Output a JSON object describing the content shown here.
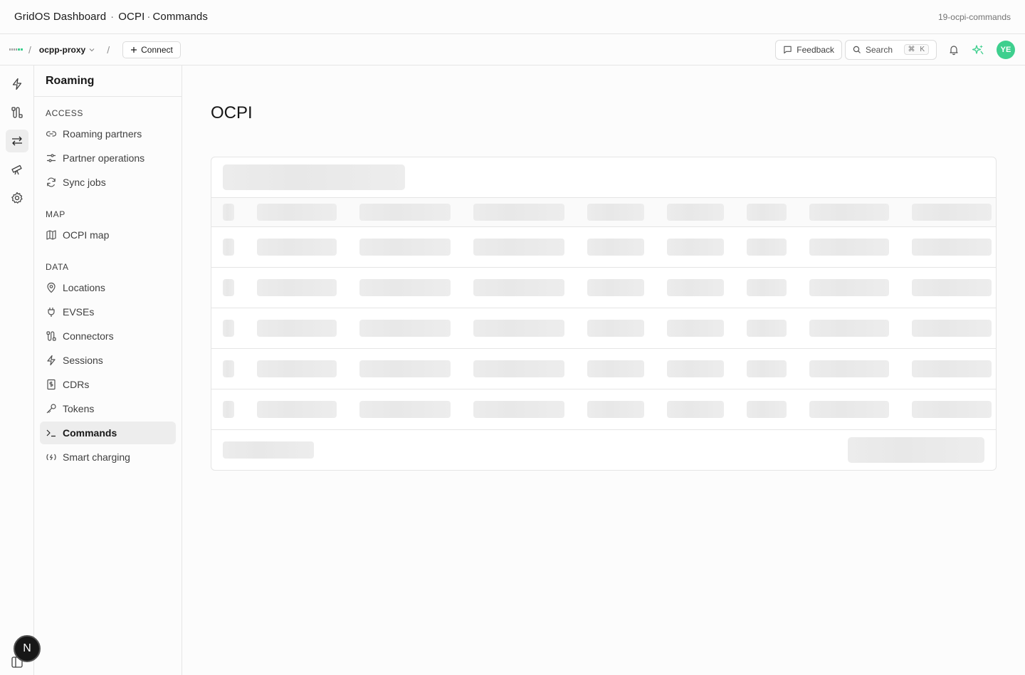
{
  "titlebar": {
    "app": "GridOS Dashboard",
    "section": "OCPI",
    "page": "Commands",
    "slug": "19-ocpi-commands"
  },
  "topnav": {
    "project": "ocpp-proxy",
    "connect_label": "Connect",
    "feedback_label": "Feedback",
    "search_label": "Search",
    "search_shortcut_mod": "⌘",
    "search_shortcut_key": "K",
    "avatar_initials": "YE"
  },
  "sidebar": {
    "title": "Roaming",
    "sections": {
      "access": "ACCESS",
      "map": "MAP",
      "data": "DATA"
    },
    "items": [
      {
        "label": "Roaming partners",
        "icon": "link-icon"
      },
      {
        "label": "Partner operations",
        "icon": "sliders-icon"
      },
      {
        "label": "Sync jobs",
        "icon": "refresh-icon"
      },
      {
        "label": "OCPI map",
        "icon": "map-icon"
      },
      {
        "label": "Locations",
        "icon": "map-pin-icon"
      },
      {
        "label": "EVSEs",
        "icon": "plug-icon"
      },
      {
        "label": "Connectors",
        "icon": "cable-icon"
      },
      {
        "label": "Sessions",
        "icon": "bolt-icon"
      },
      {
        "label": "CDRs",
        "icon": "receipt-icon"
      },
      {
        "label": "Tokens",
        "icon": "key-icon"
      },
      {
        "label": "Commands",
        "icon": "terminal-icon",
        "active": true
      },
      {
        "label": "Smart charging",
        "icon": "charging-icon"
      }
    ]
  },
  "rail": {
    "items": [
      "bolt-icon",
      "cable-icon",
      "arrows-icon",
      "telescope-icon",
      "gear-icon"
    ],
    "active": "arrows-icon",
    "badge": "N"
  },
  "main": {
    "title": "OCPI",
    "state": "loading"
  },
  "colors": {
    "accent": "#3ecf8e",
    "border": "#e5e5e5",
    "skeleton": "#ececec",
    "active_bg": "#ededed"
  }
}
